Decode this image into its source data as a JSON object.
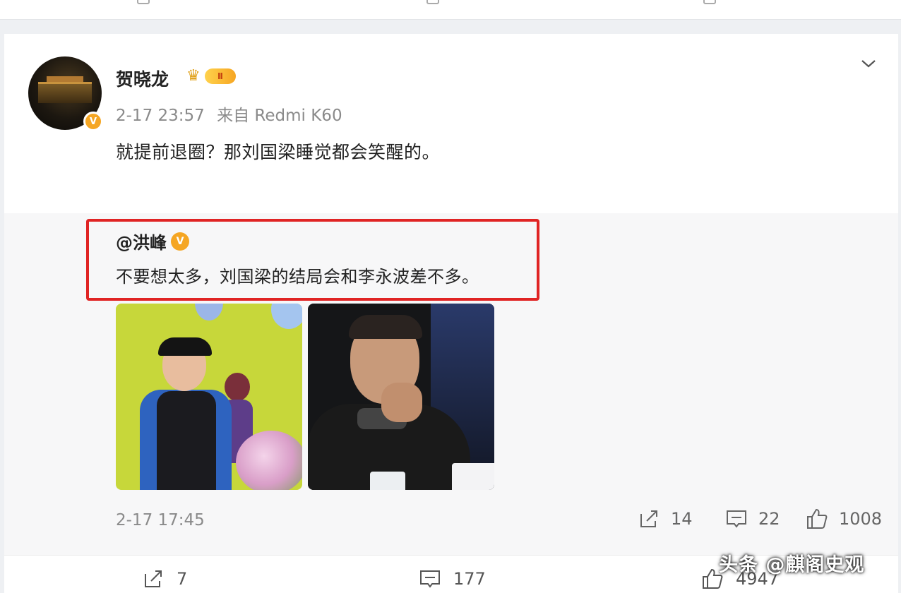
{
  "post": {
    "username": "贺晓龙",
    "vip_level": "Ⅱ",
    "timestamp": "2-17 23:57",
    "source": "来自 Redmi K60",
    "text": "就提前退圈？那刘国梁睡觉都会笑醒的。"
  },
  "repost": {
    "username": "@洪峰",
    "text": "不要想太多，刘国梁的结局会和李永波差不多。",
    "timestamp": "2-17 17:45",
    "share_count": "14",
    "comment_count": "22",
    "like_count": "1008"
  },
  "footer": {
    "share_count": "7",
    "comment_count": "177",
    "like_count": "4947"
  },
  "badges": {
    "verified_label": "V"
  },
  "watermark": "头条 @麒阁史观",
  "colors": {
    "accent_orange": "#f5a623",
    "highlight_red": "#e02424",
    "repost_bg": "#f7f7f8"
  }
}
